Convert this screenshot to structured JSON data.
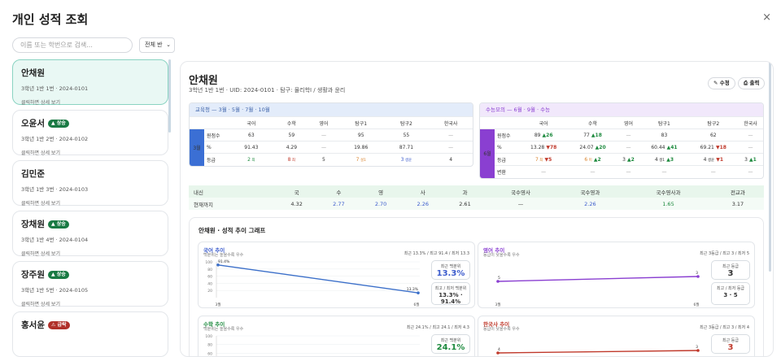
{
  "header": {
    "title": "개인 성적 조회",
    "close_label": "×"
  },
  "search": {
    "placeholder": "이름 또는 학번으로 검색...",
    "filter_value": "전체 반"
  },
  "students": [
    {
      "name": "안채원",
      "badge": "",
      "badge_type": "",
      "meta": "3학년 1반 1번 · 2024-0101",
      "hint": "클릭하면 상세 보기"
    },
    {
      "name": "오윤서",
      "badge": "▲ 상승",
      "badge_type": "up",
      "meta": "3학년 1반 2번 · 2024-0102",
      "hint": "클릭하면 상세 보기"
    },
    {
      "name": "김민준",
      "badge": "",
      "badge_type": "",
      "meta": "3학년 1반 3번 · 2024-0103",
      "hint": "클릭하면 상세 보기"
    },
    {
      "name": "장채원",
      "badge": "▲ 상승",
      "badge_type": "up",
      "meta": "3학년 1반 4번 · 2024-0104",
      "hint": "클릭하면 상세 보기"
    },
    {
      "name": "장주원",
      "badge": "▲ 상승",
      "badge_type": "up",
      "meta": "3학년 1반 5번 · 2024-0105",
      "hint": "클릭하면 상세 보기"
    },
    {
      "name": "홍서윤",
      "badge": "⚠ 급락",
      "badge_type": "down",
      "meta": "",
      "hint": ""
    }
  ],
  "detail": {
    "name": "안채원",
    "info": "3학년 1반 1번 · UID: 2024-0101 · 탐구: 물리학Ⅰ / 생활과 윤리",
    "edit_label": "✎ 수정",
    "print_label": "⎙ 출력"
  },
  "edu_panel": {
    "title": "교육청 — 3월 · 5월 · 7월 · 10월",
    "headers": [
      "국어",
      "수학",
      "영어",
      "탐구1",
      "탐구2",
      "한국사"
    ],
    "month": "3월",
    "rows": [
      {
        "label": "원점수",
        "cells": [
          {
            "t": "63"
          },
          {
            "t": "59"
          },
          {
            "t": "—",
            "c": "gry"
          },
          {
            "t": "95"
          },
          {
            "t": "55"
          },
          {
            "t": "—",
            "c": "gry"
          }
        ]
      },
      {
        "label": "%",
        "cells": [
          {
            "t": "91.43"
          },
          {
            "t": "4.29"
          },
          {
            "t": "—",
            "c": "gry"
          },
          {
            "t": "19.86"
          },
          {
            "t": "87.71"
          },
          {
            "t": "—",
            "c": "gry"
          }
        ]
      },
      {
        "label": "등급",
        "cells": [
          {
            "t": "2",
            "c": "grn",
            "s": "최"
          },
          {
            "t": "8",
            "c": "red",
            "s": "최"
          },
          {
            "t": "5"
          },
          {
            "t": "7",
            "c": "org",
            "s": "설1"
          },
          {
            "t": "3",
            "c": "blu",
            "s": "생윤"
          },
          {
            "t": "4"
          }
        ]
      }
    ]
  },
  "mock_panel": {
    "title": "수능모의 — 6월 · 9월 · 수능",
    "headers": [
      "국어",
      "수학",
      "영어",
      "탐구1",
      "탐구2",
      "한국사"
    ],
    "month": "6월",
    "rows": [
      {
        "label": "원점수",
        "cells": [
          {
            "t": "89",
            "d": "▲26",
            "dc": "grn"
          },
          {
            "t": "77",
            "d": "▲18",
            "dc": "grn"
          },
          {
            "t": "—",
            "c": "gry"
          },
          {
            "t": "83"
          },
          {
            "t": "62"
          },
          {
            "t": "—",
            "c": "gry"
          }
        ]
      },
      {
        "label": "%",
        "cells": [
          {
            "t": "13.28",
            "d": "▼78",
            "dc": "red"
          },
          {
            "t": "24.07",
            "d": "▲20",
            "dc": "grn"
          },
          {
            "t": "—",
            "c": "gry"
          },
          {
            "t": "60.44",
            "d": "▲41",
            "dc": "grn"
          },
          {
            "t": "69.21",
            "d": "▼18",
            "dc": "red"
          },
          {
            "t": "—",
            "c": "gry"
          }
        ]
      },
      {
        "label": "등급",
        "cells": [
          {
            "t": "7",
            "c": "org",
            "s": "최",
            "d": "▼5",
            "dc": "red"
          },
          {
            "t": "6",
            "c": "org",
            "s": "미",
            "d": "▲2",
            "dc": "grn"
          },
          {
            "t": "3",
            "d": "▲2",
            "dc": "grn"
          },
          {
            "t": "4",
            "s": "생1",
            "d": "▲3",
            "dc": "grn"
          },
          {
            "t": "4",
            "s": "생윤",
            "d": "▼1",
            "dc": "red"
          },
          {
            "t": "3",
            "d": "▲1",
            "dc": "grn"
          }
        ]
      },
      {
        "label": "변환",
        "cells": [
          {
            "t": "—",
            "c": "gry"
          },
          {
            "t": "—",
            "c": "gry"
          },
          {
            "t": "—",
            "c": "gry"
          },
          {
            "t": "—",
            "c": "gry"
          },
          {
            "t": "—",
            "c": "gry"
          },
          {
            "t": "—",
            "c": "gry"
          }
        ]
      }
    ]
  },
  "average": {
    "headers": [
      "내신",
      "국",
      "수",
      "영",
      "사",
      "과",
      "국수영사",
      "국수영과",
      "국수영사과",
      "전교과"
    ],
    "row_label": "현재까지",
    "values": [
      "4.32",
      "2.77",
      "2.70",
      "2.26",
      "2.61",
      "—",
      "2.26",
      "1.65",
      "3.17"
    ]
  },
  "charts_title": "안채원 · 성적 추이 그래프",
  "charts": [
    {
      "title": "국어 추이",
      "title_color": "#3b5bcc",
      "subtitle": "백분위는 높을수록 우수",
      "summary": "최근 13.3% / 최고 91.4 / 최저 13.3",
      "stat1_label": "최근 백분위",
      "stat1_value": "13.3%",
      "stat1_color": "#3b5bcc",
      "stat2_label": "최고 / 최저 백분위",
      "stat2_value": "13.3% ·\n91.4%",
      "stat2_color": "#333",
      "yticks": [
        "100",
        "80",
        "60",
        "40",
        "20"
      ],
      "xlabels": [
        "3월",
        "6월"
      ],
      "points": [
        "91.4%",
        "13.3%"
      ],
      "line_color": "#3b6fc9"
    },
    {
      "title": "영어 추이",
      "title_color": "#8a3fd1",
      "subtitle": "등급이 낮을수록 우수",
      "summary": "최근 3등급 / 최고 3 / 최저 5",
      "stat1_label": "최근 등급",
      "stat1_value": "3",
      "stat1_color": "#333",
      "stat2_label": "최고 / 최저 등급",
      "stat2_value": "3 · 5",
      "stat2_color": "#333",
      "yticks": [],
      "xlabels": [
        "3월",
        "6월"
      ],
      "points": [
        "5",
        "3"
      ],
      "line_color": "#8a3fd1"
    },
    {
      "title": "수학 추이",
      "title_color": "#1d8a3e",
      "subtitle": "백분위는 높을수록 우수",
      "summary": "최근 24.1% / 최고 24.1 / 최저 4.3",
      "stat1_label": "최근 백분위",
      "stat1_value": "24.1%",
      "stat1_color": "#1d8a3e",
      "stat2_label": "",
      "stat2_value": "",
      "stat2_color": "#333",
      "yticks": [
        "100",
        "80",
        "60"
      ],
      "xlabels": [],
      "points": [],
      "line_color": "#1d8a3e"
    },
    {
      "title": "한국사 추이",
      "title_color": "#c0392b",
      "subtitle": "등급이 낮을수록 우수",
      "summary": "최근 3등급 / 최고 3 / 최저 4",
      "stat1_label": "최근 등급",
      "stat1_value": "3",
      "stat1_color": "#c0392b",
      "stat2_label": "",
      "stat2_value": "",
      "stat2_color": "#333",
      "yticks": [],
      "xlabels": [],
      "points": [
        "4",
        "3"
      ],
      "line_color": "#c0392b"
    }
  ]
}
